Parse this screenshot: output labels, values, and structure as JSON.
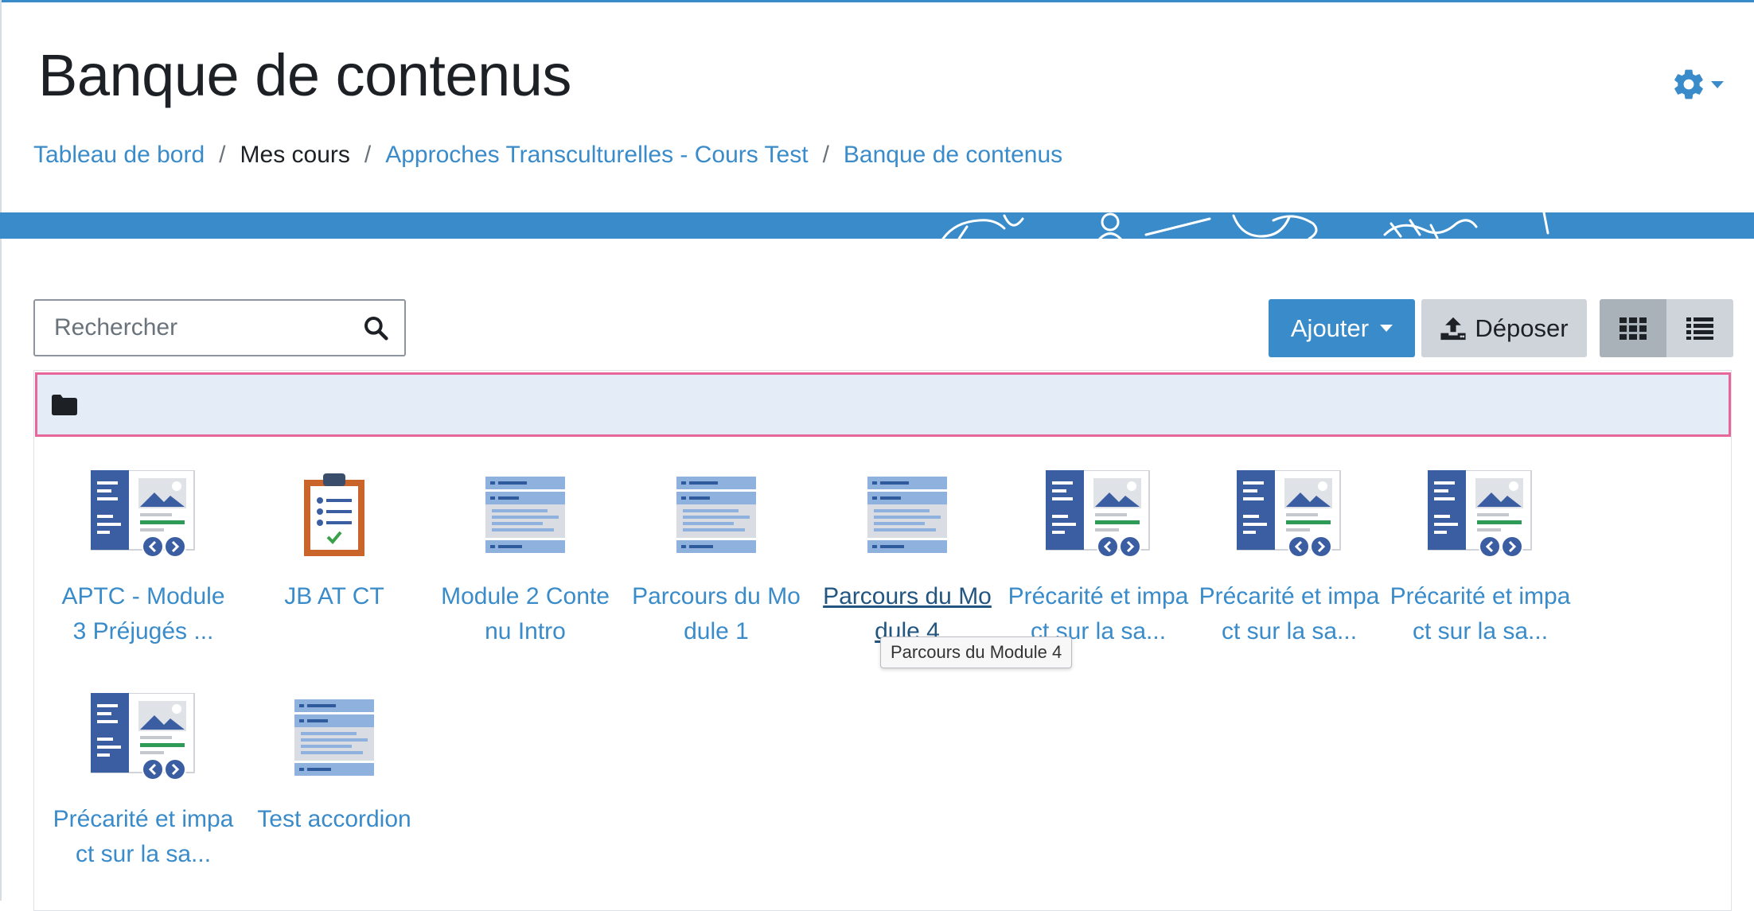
{
  "page": {
    "title": "Banque de contenus"
  },
  "breadcrumb": [
    {
      "label": "Tableau de bord",
      "link": true
    },
    {
      "label": "Mes cours",
      "link": false
    },
    {
      "label": "Approches Transculturelles - Cours Test",
      "link": true
    },
    {
      "label": "Banque de contenus",
      "link": true
    }
  ],
  "breadcrumb_separator": "/",
  "search": {
    "placeholder": "Rechercher",
    "icon": "search-icon"
  },
  "toolbar": {
    "add_label": "Ajouter",
    "upload_label": "Déposer",
    "grid_view_icon": "grid-view-icon",
    "list_view_icon": "list-view-icon"
  },
  "settings": {
    "icon": "gear-icon"
  },
  "folder": {
    "icon": "folder-icon"
  },
  "colors": {
    "accent": "#3a8bc9",
    "folder_bar_bg": "#e3ecf7",
    "folder_bar_border": "#e7679a",
    "secondary_button": "#ced4da"
  },
  "items": [
    {
      "label": "APTC - Module 3 Préjugés ...",
      "icon": "course-presentation-icon"
    },
    {
      "label": "JB AT CT",
      "icon": "questionnaire-icon"
    },
    {
      "label": "Module 2 Contenu Intro",
      "icon": "accordion-icon"
    },
    {
      "label": "Parcours du Module 1",
      "icon": "accordion-icon"
    },
    {
      "label": "Parcours du Module 4",
      "icon": "accordion-icon"
    },
    {
      "label": "Précarité et impact sur la sa...",
      "icon": "course-presentation-icon"
    },
    {
      "label": "Précarité et impact sur la sa...",
      "icon": "course-presentation-icon"
    },
    {
      "label": "Précarité et impact sur la sa...",
      "icon": "course-presentation-icon"
    },
    {
      "label": "Précarité et impact sur la sa...",
      "icon": "course-presentation-icon"
    },
    {
      "label": "Test accordion",
      "icon": "accordion-icon"
    }
  ],
  "tooltip": {
    "text": "Parcours du Module 4"
  }
}
